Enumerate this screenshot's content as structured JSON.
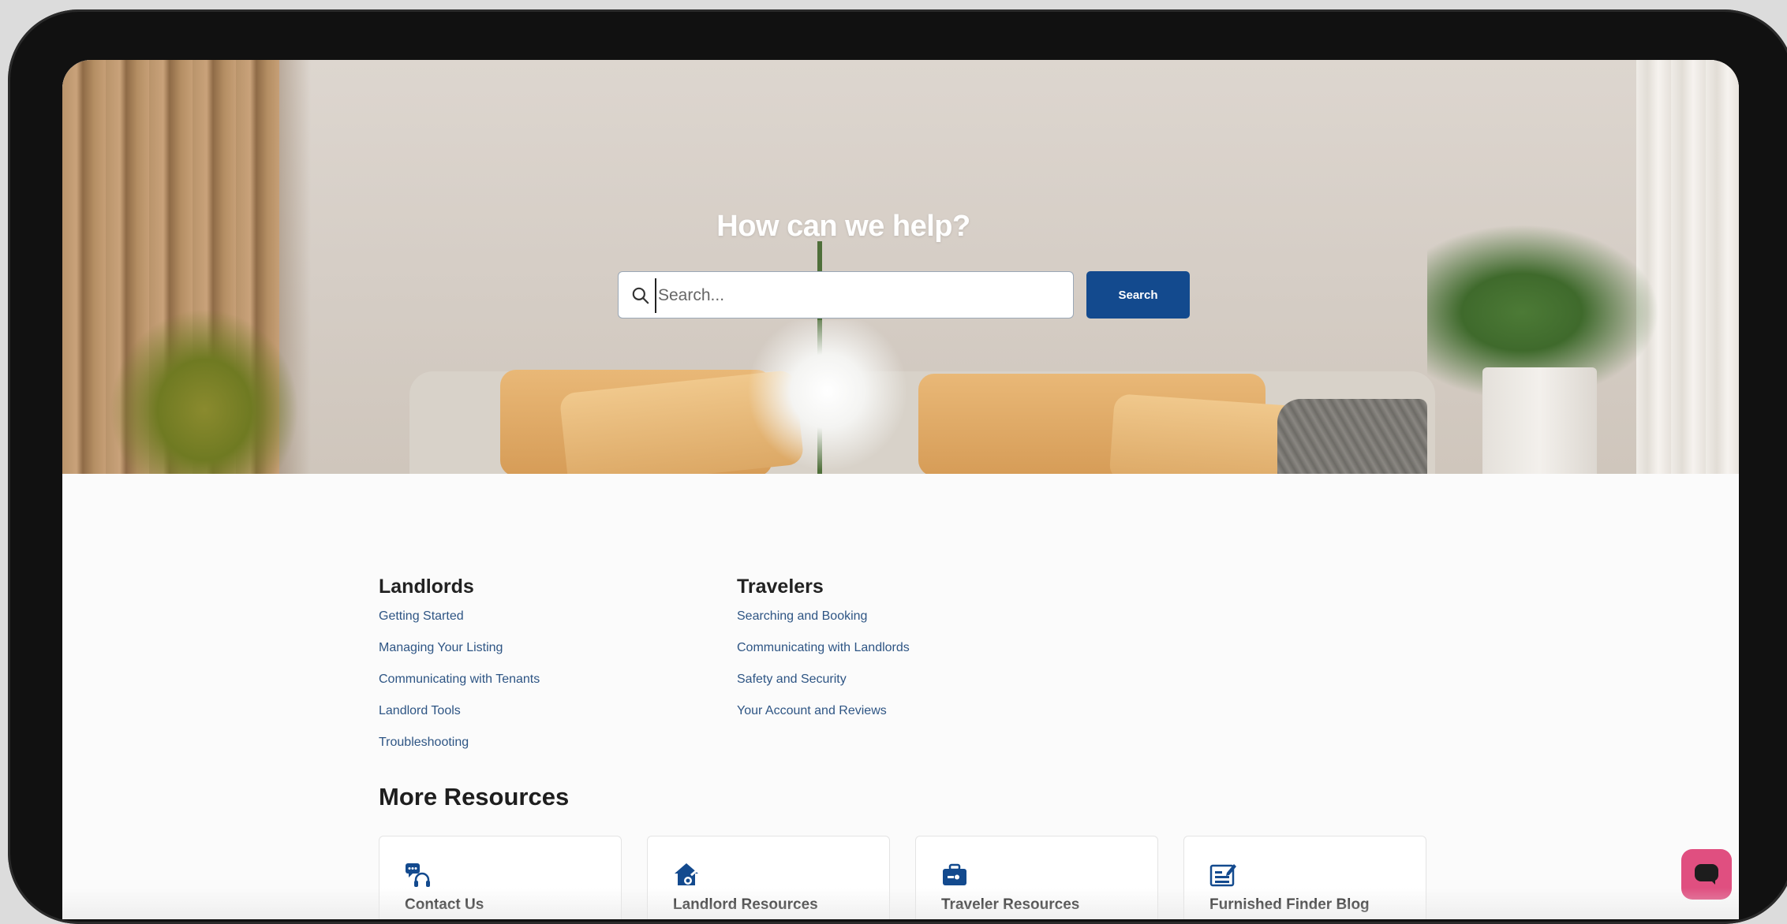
{
  "hero": {
    "title": "How can we help?",
    "search_placeholder": "Search...",
    "search_button": "Search"
  },
  "landlords": {
    "heading": "Landlords",
    "links": [
      "Getting Started",
      "Managing Your Listing",
      "Communicating with Tenants",
      "Landlord Tools",
      "Troubleshooting"
    ]
  },
  "travelers": {
    "heading": "Travelers",
    "links": [
      "Searching and Booking",
      "Communicating with Landlords",
      "Safety and Security",
      "Your Account and Reviews"
    ]
  },
  "more_resources": {
    "heading": "More Resources",
    "cards": [
      {
        "label": "Contact Us",
        "icon": "headset-chat-icon"
      },
      {
        "label": "Landlord Resources",
        "icon": "house-key-icon"
      },
      {
        "label": "Traveler Resources",
        "icon": "briefcase-icon"
      },
      {
        "label": "Furnished Finder Blog",
        "icon": "blog-edit-icon"
      }
    ]
  },
  "colors": {
    "primary": "#134a8e",
    "link": "#2e5584",
    "chat": "#e04f80"
  },
  "chat": {
    "icon": "chat-icon"
  }
}
